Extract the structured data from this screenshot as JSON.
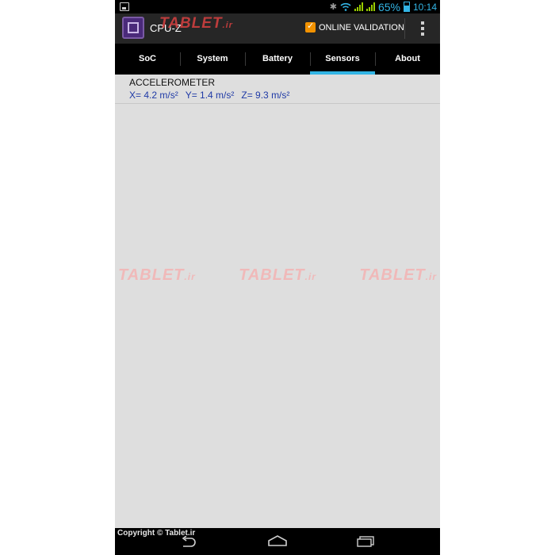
{
  "status_bar": {
    "battery_percent": "65%",
    "time": "10:14",
    "icons": [
      "image-icon",
      "bluetooth-icon",
      "wifi-icon",
      "signal-icon",
      "battery-icon"
    ]
  },
  "action_bar": {
    "app_title": "CPU-Z",
    "watermark": "TABLET",
    "watermark_suffix": ".ir",
    "validation_label": "ONLINE VALIDATION",
    "icons": [
      "cpu-z-app-icon",
      "validation-icon",
      "overflow-menu-icon"
    ]
  },
  "tabs": [
    {
      "label": "SoC",
      "active": false
    },
    {
      "label": "System",
      "active": false
    },
    {
      "label": "Battery",
      "active": false
    },
    {
      "label": "Sensors",
      "active": true
    },
    {
      "label": "About",
      "active": false
    }
  ],
  "sensors": {
    "title": "ACCELEROMETER",
    "x": "X= 4.2 m/s²",
    "y": "Y= 1.4 m/s²",
    "z": "Z= 9.3 m/s²"
  },
  "watermarks": [
    "TABLET",
    "TABLET",
    "TABLET"
  ],
  "watermark_suffix": ".ir",
  "nav_bar": {
    "copyright": "Copyright © Tablet.ir",
    "icons": [
      "back-icon",
      "home-icon",
      "recent-apps-icon"
    ]
  },
  "colors": {
    "accent": "#33b5e5",
    "value_text": "#1f3aa6",
    "content_bg": "#dedede",
    "watermark": "#d84040"
  }
}
